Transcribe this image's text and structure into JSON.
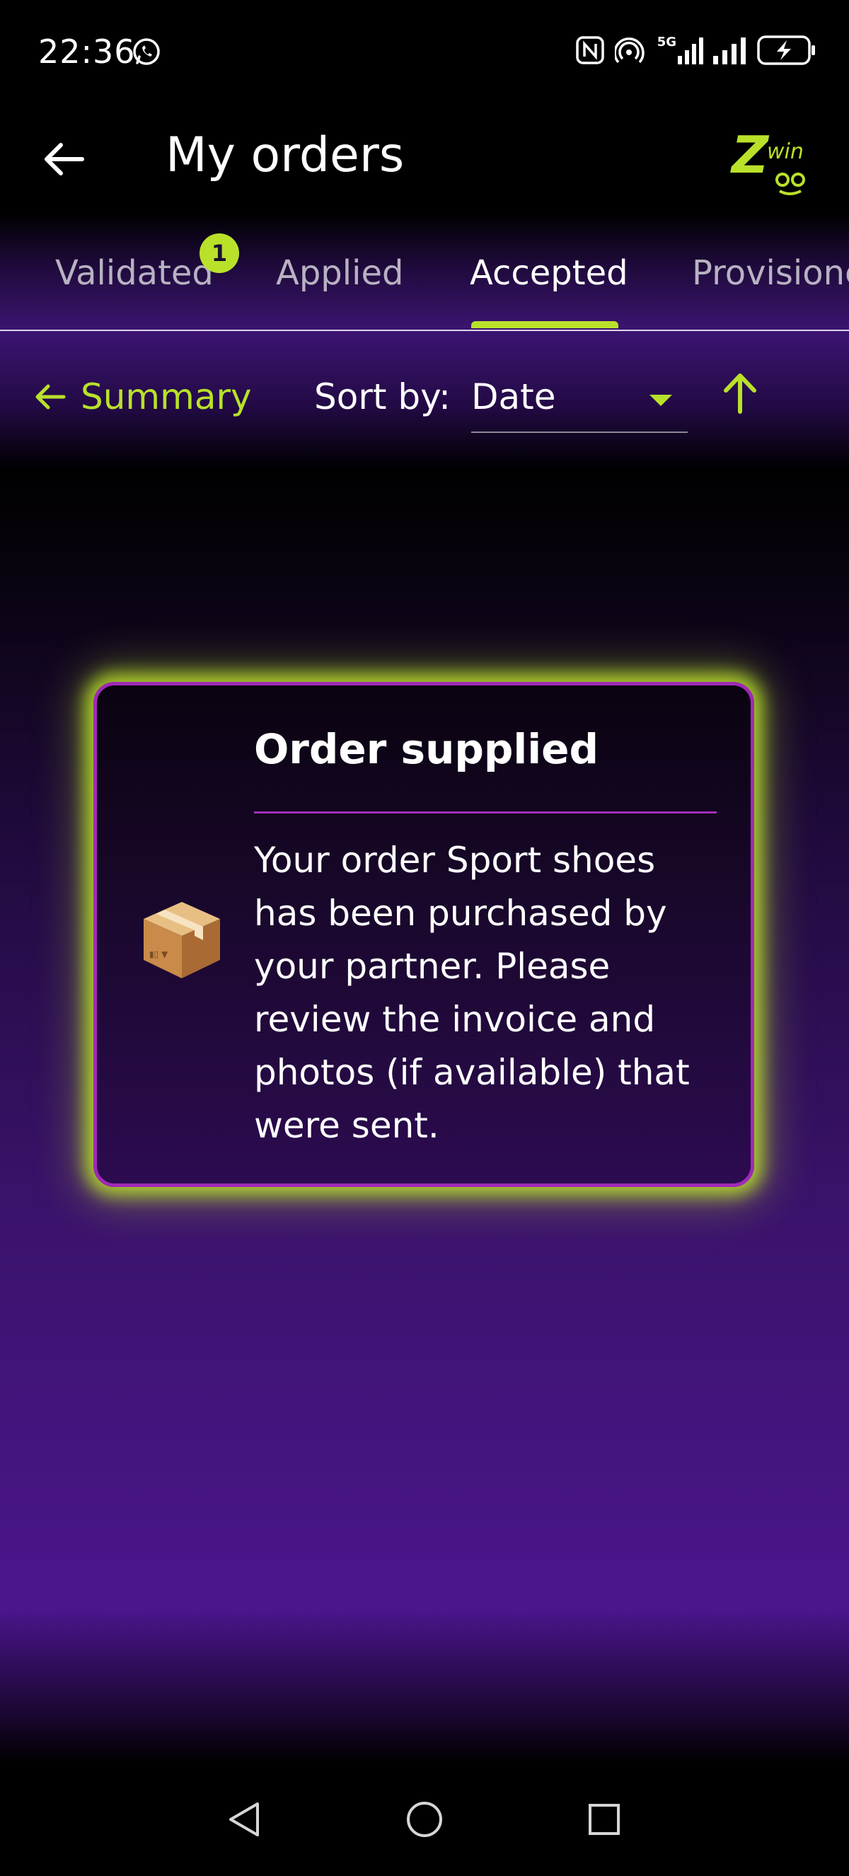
{
  "status_bar": {
    "time": "22:36",
    "network_label": "5G",
    "icons": [
      "whatsapp-icon",
      "nfc-icon",
      "hotspot-icon",
      "signal-icon",
      "battery-charging-icon"
    ]
  },
  "app_bar": {
    "title": "My orders",
    "back_icon": "arrow-left-icon",
    "logo_text": "Zwin"
  },
  "tabs": [
    {
      "label": "Validated",
      "badge": "1",
      "active": false
    },
    {
      "label": "Applied",
      "active": false
    },
    {
      "label": "Accepted",
      "active": true
    },
    {
      "label": "Provisioned",
      "active": false
    }
  ],
  "sort_bar": {
    "summary_label": "Summary",
    "sort_label": "Sort by:",
    "sort_value": "Date",
    "sort_direction_icon": "arrow-up-icon"
  },
  "notification_card": {
    "icon": "package-icon",
    "title": "Order supplied",
    "body": "Your order Sport shoes has been purchased by your partner. Please review the invoice and photos (if available) that were sent."
  },
  "nav_bar": {
    "icons": [
      "back-triangle-icon",
      "home-circle-icon",
      "recents-square-icon"
    ]
  },
  "colors": {
    "accent": "#b9e12a",
    "border_purple": "#9f2ab5",
    "background_purple": "#4a168c"
  }
}
